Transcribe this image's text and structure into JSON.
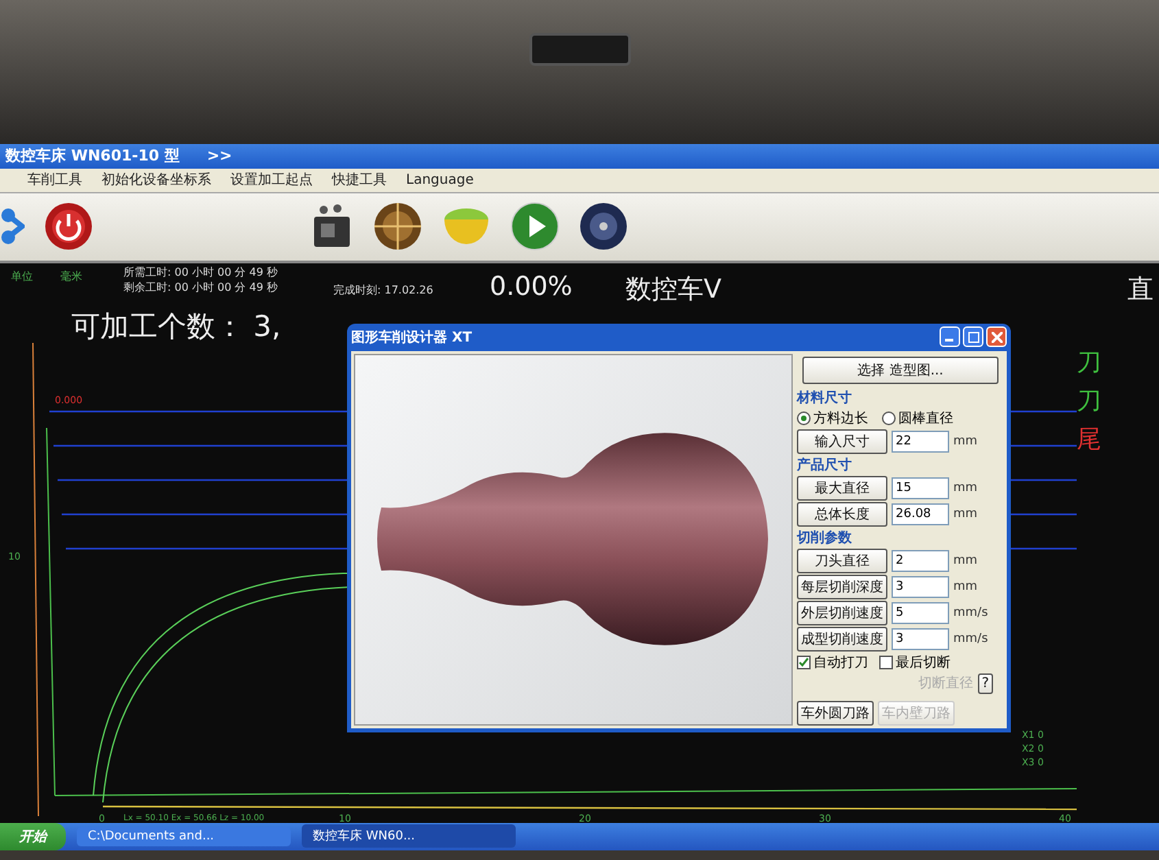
{
  "window": {
    "title": "数控车床 WN601-10 型",
    "title_extra": ">>"
  },
  "menu": [
    {
      "label": "车削工具"
    },
    {
      "label": "初始化设备坐标系"
    },
    {
      "label": "设置加工起点"
    },
    {
      "label": "快捷工具"
    },
    {
      "label": "Language"
    }
  ],
  "status": {
    "unit_label": "单位",
    "unit": "毫米",
    "time_required": "所需工时: 00 小时 00 分 49 秒",
    "time_left": "剩余工时: 00 小时 00 分 49 秒",
    "finish_time": "完成时刻: 17.02.26",
    "progress": "0.00%",
    "product": "数控车V",
    "right_text": "直",
    "count": "可加工个数： 3,"
  },
  "side_labels": [
    {
      "text": "刀",
      "color": "#3fc03f"
    },
    {
      "text": "刀",
      "color": "#3fc03f"
    },
    {
      "text": "尾",
      "color": "#e03030"
    }
  ],
  "plot": {
    "origin_label": "0.000",
    "y_labels": [
      "10"
    ],
    "x_labels": [
      "0",
      "10",
      "20",
      "30",
      "40"
    ],
    "readout": "Lx = 50.10  Ex = 50.66  Lz = 10.00",
    "axes": [
      {
        "name": "X1",
        "value": "0"
      },
      {
        "name": "X2",
        "value": "0"
      },
      {
        "name": "X3",
        "value": "0"
      }
    ]
  },
  "dialog": {
    "title": "图形车削设计器 XT",
    "select_button": "选择 造型图...",
    "sections": [
      {
        "heading": "材料尺寸",
        "options": [
          {
            "label": "方料边长",
            "selected": true
          },
          {
            "label": "圆棒直径",
            "selected": false
          }
        ],
        "fields": [
          {
            "label": "输入尺寸",
            "value": "22",
            "unit": "mm"
          }
        ]
      },
      {
        "heading": "产品尺寸",
        "fields": [
          {
            "label": "最大直径",
            "value": "15",
            "unit": "mm"
          },
          {
            "label": "总体长度",
            "value": "26.08",
            "unit": "mm"
          }
        ]
      },
      {
        "heading": "切削参数",
        "fields": [
          {
            "label": "刀头直径",
            "value": "2",
            "unit": "mm"
          },
          {
            "label": "每层切削深度",
            "value": "3",
            "unit": "mm"
          },
          {
            "label": "外层切削速度",
            "value": "5",
            "unit": "mm/s"
          },
          {
            "label": "成型切削速度",
            "value": "3",
            "unit": "mm/s"
          }
        ]
      }
    ],
    "options": [
      {
        "label": "自动打刀",
        "checked": true
      },
      {
        "label": "最后切断",
        "checked": false
      }
    ],
    "cutoff": {
      "label": "切断直径",
      "disabled": true
    },
    "help_button": "?",
    "actions": [
      {
        "label": "车外圆刀路",
        "disabled": false
      },
      {
        "label": "车内壁刀路",
        "disabled": true
      }
    ]
  },
  "taskbar": {
    "start": "开始",
    "tasks": [
      {
        "label": "C:\\Documents and...",
        "selected": false
      },
      {
        "label": "数控车床 WN60...",
        "selected": true
      }
    ]
  }
}
